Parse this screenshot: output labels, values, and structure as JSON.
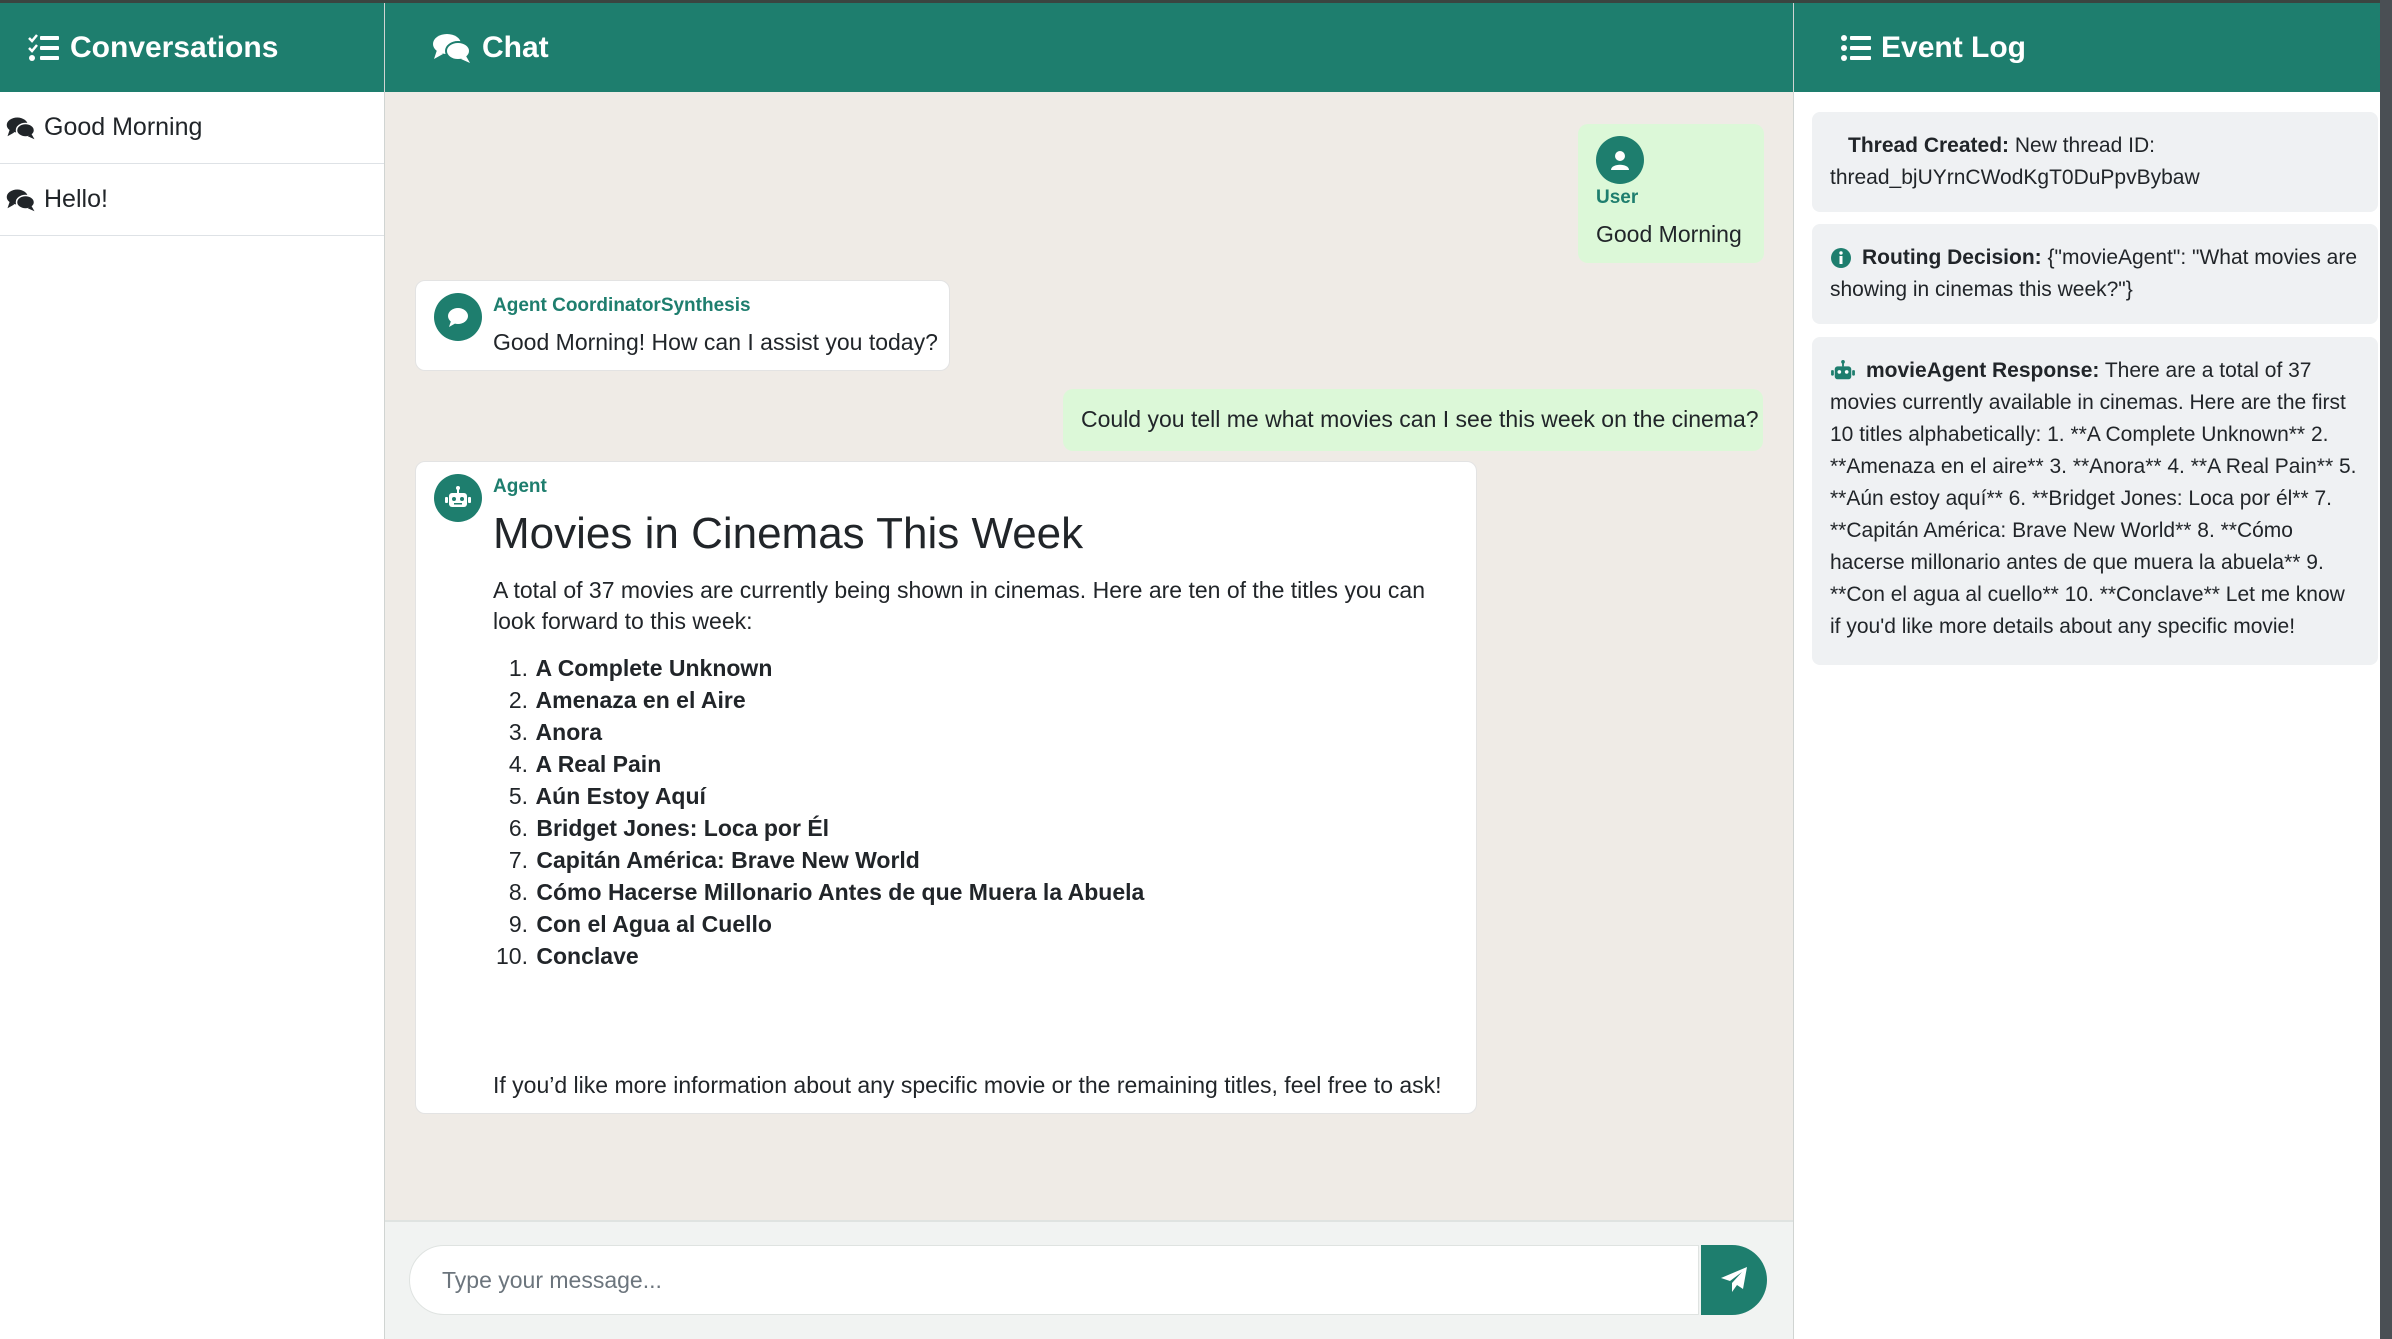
{
  "colors": {
    "brand": "#1e7e6e",
    "user_bubble": "#dcf8d8",
    "chat_bg": "#efebe6",
    "log_card": "#eff1f3"
  },
  "headers": {
    "conversations": "Conversations",
    "chat": "Chat",
    "event_log": "Event Log"
  },
  "sidebar": {
    "items": [
      {
        "label": "Good Morning",
        "icon": "comments-icon"
      },
      {
        "label": "Hello!",
        "icon": "comments-icon"
      }
    ]
  },
  "chat": {
    "messages": [
      {
        "role": "user",
        "sender": "User",
        "text": "Good Morning",
        "icon": "user-icon"
      },
      {
        "role": "agent",
        "sender": "Agent CoordinatorSynthesis",
        "text": "Good Morning! How can I assist you today?",
        "icon": "comment-icon"
      },
      {
        "role": "user",
        "text": "Could you tell me what movies can I see this week on the cinema?"
      },
      {
        "role": "agent",
        "sender": "Agent",
        "icon": "robot-icon",
        "title": "Movies in Cinemas This Week",
        "intro": "A total of 37 movies are currently being shown in cinemas. Here are ten of the titles you can look forward to this week:",
        "list": [
          {
            "n": "1.",
            "t": "A Complete Unknown"
          },
          {
            "n": "2.",
            "t": "Amenaza en el Aire"
          },
          {
            "n": "3.",
            "t": "Anora"
          },
          {
            "n": "4.",
            "t": "A Real Pain"
          },
          {
            "n": "5.",
            "t": "Aún Estoy Aquí"
          },
          {
            "n": "6.",
            "t": "Bridget Jones: Loca por Él"
          },
          {
            "n": "7.",
            "t": "Capitán América: Brave New World"
          },
          {
            "n": "8.",
            "t": "Cómo Hacerse Millonario Antes de que Muera la Abuela"
          },
          {
            "n": "9.",
            "t": "Con el Agua al Cuello"
          },
          {
            "n": "10.",
            "t": "Conclave"
          }
        ],
        "outro": "If you’d like more information about any specific movie or the remaining titles, feel free to ask!"
      }
    ]
  },
  "composer": {
    "placeholder": "Type your message...",
    "send_icon": "paper-plane-icon"
  },
  "event_log": [
    {
      "label": "Thread Created:",
      "text": " New thread ID: thread_bjUYrnCWodKgT0DuPpvBybaw",
      "icon": "none"
    },
    {
      "label": "Routing Decision:",
      "text": " {\"movieAgent\": \"What movies are showing in cinemas this week?\"}",
      "icon": "info-icon"
    },
    {
      "label": "movieAgent Response:",
      "text": " There are a total of 37 movies currently available in cinemas. Here are the first 10 titles alphabetically: 1. **A Complete Unknown** 2. **Amenaza en el aire** 3. **Anora** 4. **A Real Pain** 5. **Aún estoy aquí** 6. **Bridget Jones: Loca por él** 7. **Capitán América: Brave New World** 8. **Cómo hacerse millonario antes de que muera la abuela** 9. **Con el agua al cuello** 10. **Conclave** Let me know if you'd like more details about any specific movie!",
      "icon": "robot-icon"
    }
  ]
}
